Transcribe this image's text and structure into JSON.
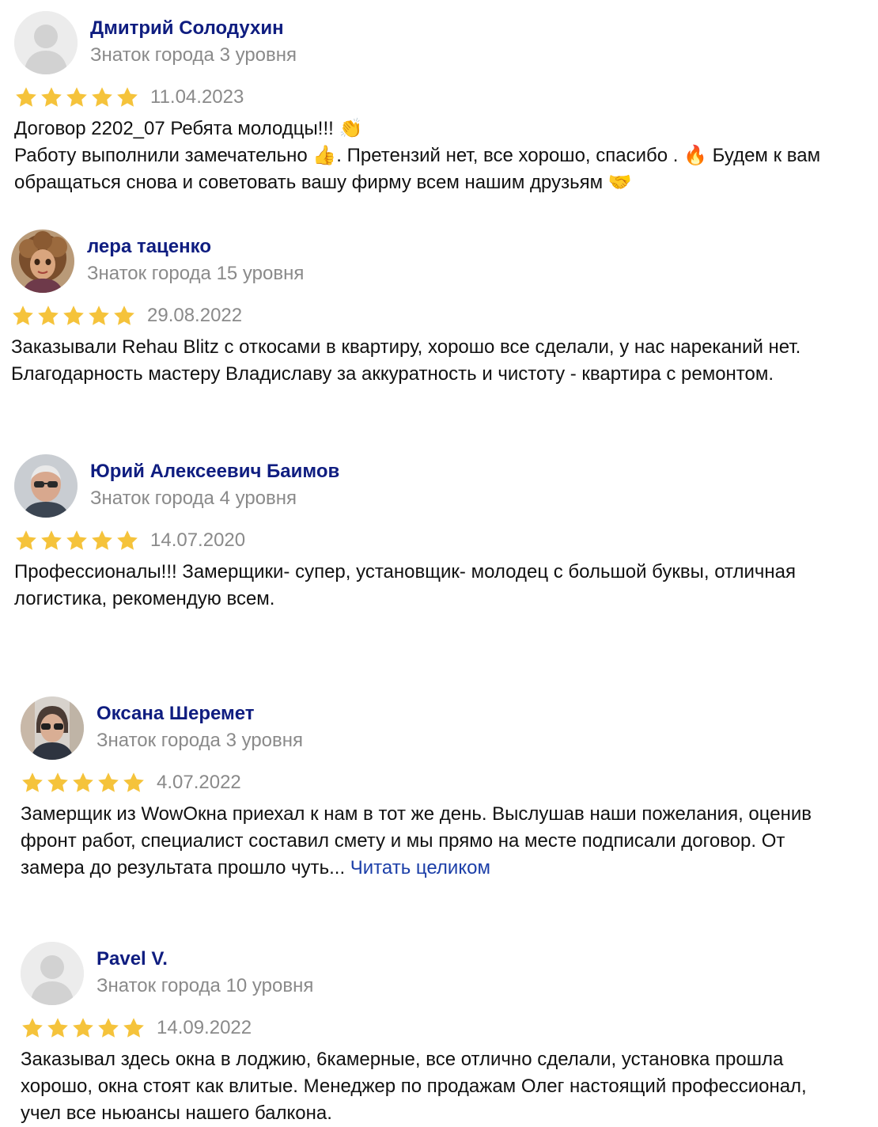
{
  "colors": {
    "name": "#0f1d80",
    "muted": "#8a8a8a",
    "star": "#f5c33b",
    "link": "#1b3ea8"
  },
  "reviews": [
    {
      "name": "Дмитрий Солодухин",
      "level": "Знаток города 3 уровня",
      "rating": 5,
      "date": "11.04.2023",
      "lines": [
        "Договор 2202_07 Ребята молодцы!!! 👏",
        "Работу выполнили замечательно 👍. Претензий нет, все хорошо, спасибо . 🔥 Будем к вам обращаться снова и советовать вашу фирму всем нашим друзьям 🤝"
      ]
    },
    {
      "name": "лера таценко",
      "level": "Знаток города 15 уровня",
      "rating": 5,
      "date": "29.08.2022",
      "lines": [
        "Заказывали Rehau Blitz с откосами в квартиру, хорошо все сделали, у нас нареканий нет. Благодарность мастеру Владиславу за аккуратность и чистоту - квартира с ремонтом."
      ]
    },
    {
      "name": "Юрий Алексеевич Баимов",
      "level": "Знаток города 4 уровня",
      "rating": 5,
      "date": "14.07.2020",
      "lines": [
        "Профессионалы!!! Замерщики- супер, установщик- молодец с большой буквы, отличная логистика, рекомендую всем."
      ]
    },
    {
      "name": "Оксана Шеремет",
      "level": "Знаток города 3 уровня",
      "rating": 5,
      "date": "4.07.2022",
      "lines": [
        "Замерщик из WowОкна приехал к нам в тот же день. Выслушав наши пожелания, оценив фронт работ, специалист составил смету и мы прямо на месте подписали договор. От замера до результата прошло чуть..."
      ],
      "read_more": "Читать целиком"
    },
    {
      "name": "Pavel V.",
      "level": "Знаток города 10 уровня",
      "rating": 5,
      "date": "14.09.2022",
      "lines": [
        "Заказывал здесь окна в лоджию, 6камерные, все отлично сделали, установка прошла хорошо, окна стоят как влитые. Менеджер по продажам Олег настоящий профессионал, учел все ньюансы нашего балкона."
      ]
    }
  ]
}
